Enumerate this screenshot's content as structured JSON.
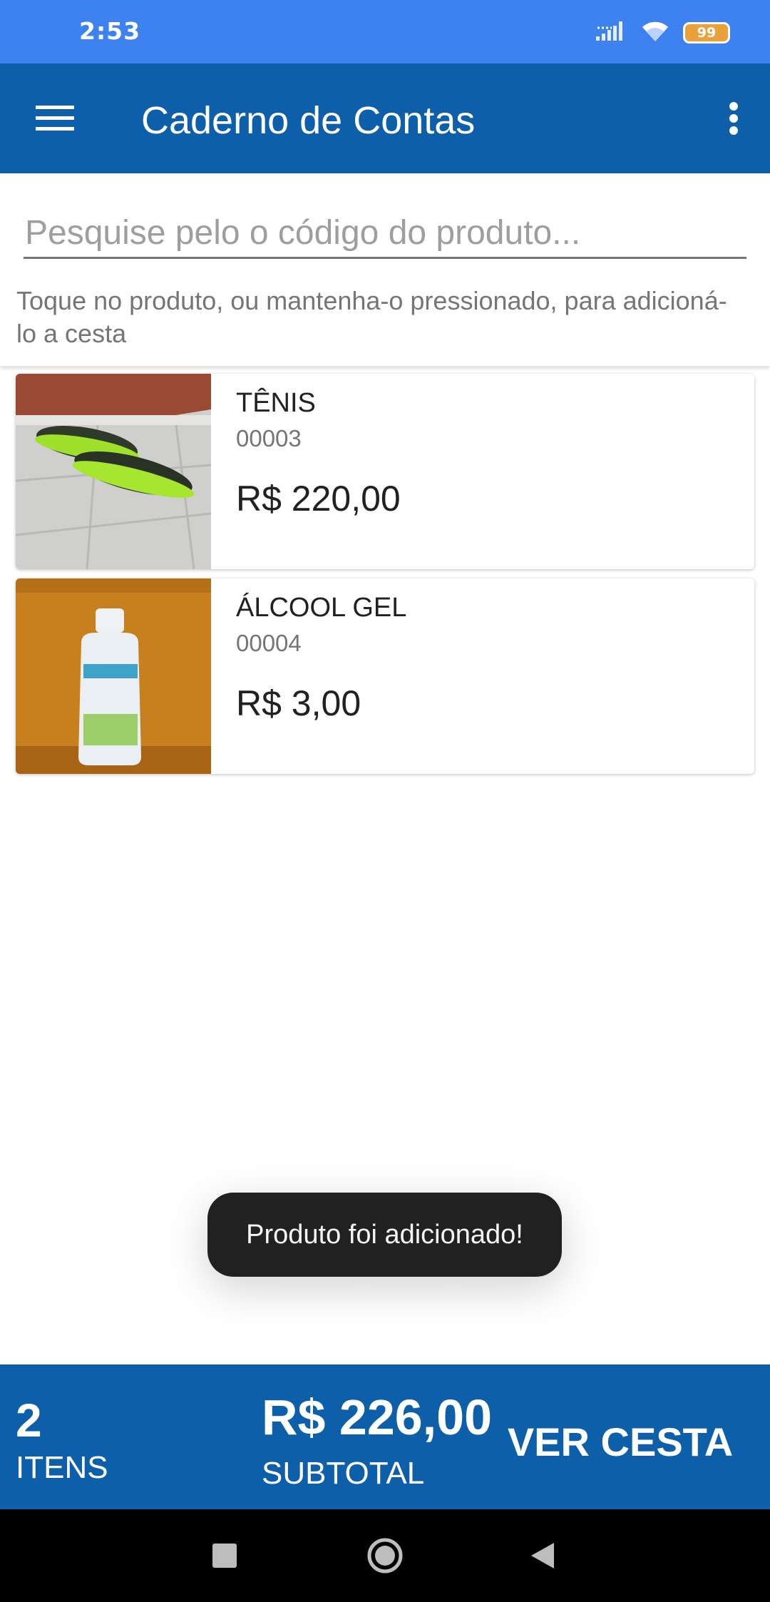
{
  "status_bar": {
    "time": "2:53",
    "battery_level": "99",
    "icons": [
      "signal-icon",
      "wifi-icon",
      "battery-icon"
    ]
  },
  "app_bar": {
    "title": "Caderno de Contas",
    "menu_icon": "hamburger-menu-icon",
    "overflow_icon": "more-vert-icon"
  },
  "search": {
    "placeholder": "Pesquise pelo o código do produto...",
    "value": "",
    "hint": "Toque no produto, ou mantenha-o pressionado, para adicioná-lo a cesta"
  },
  "products": [
    {
      "name": "TÊNIS",
      "code": "00003",
      "price": "R$ 220,00",
      "image": "sneakers-photo"
    },
    {
      "name": "ÁLCOOL GEL",
      "code": "00004",
      "price": "R$ 3,00",
      "image": "hand-sanitizer-photo"
    }
  ],
  "toast": {
    "message": "Produto foi adicionado!"
  },
  "cart": {
    "count": "2",
    "count_label": "ITENS",
    "total": "R$ 226,00",
    "total_label": "SUBTOTAL",
    "view_cart_label": "VER CESTA"
  },
  "colors": {
    "status_bar": "#3d82f0",
    "primary": "#0c5fa8",
    "toast_bg": "#212121",
    "battery": "#e9a23b"
  }
}
